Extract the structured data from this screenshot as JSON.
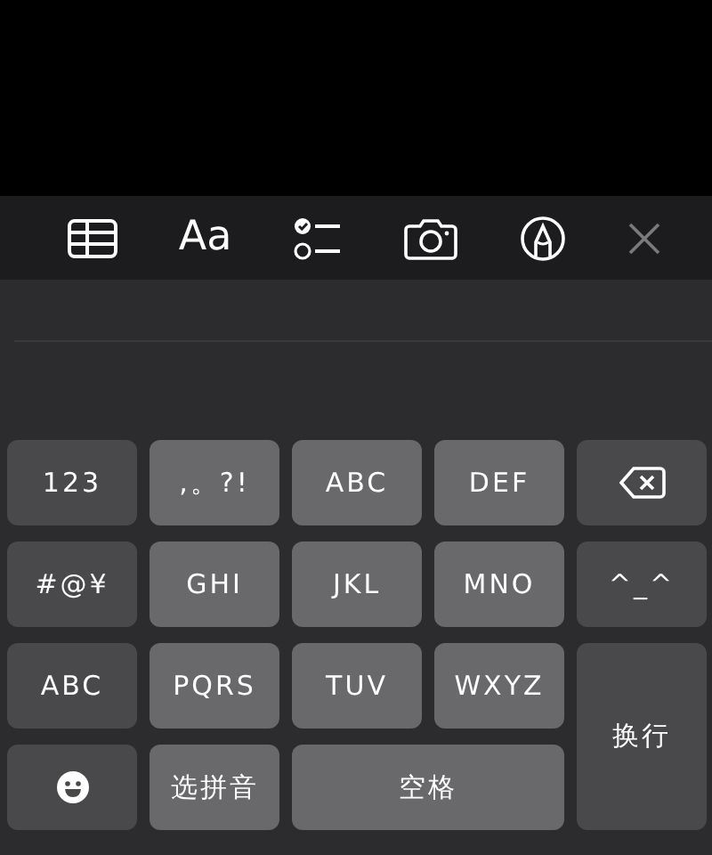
{
  "toolbar": [
    {
      "kind": "table"
    },
    {
      "kind": "format",
      "label": "Aa"
    },
    {
      "kind": "checklist"
    },
    {
      "kind": "camera"
    },
    {
      "kind": "markup"
    },
    {
      "kind": "close",
      "disabled": true
    }
  ],
  "keys": [
    {
      "kind": "function",
      "label": "123"
    },
    {
      "kind": "letter",
      "label": ",。?!"
    },
    {
      "kind": "letter",
      "label": "ABC"
    },
    {
      "kind": "letter",
      "label": "DEF"
    },
    {
      "kind": "delete"
    },
    {
      "kind": "function",
      "label": "#@¥"
    },
    {
      "kind": "letter",
      "label": "GHI"
    },
    {
      "kind": "letter",
      "label": "JKL"
    },
    {
      "kind": "letter",
      "label": "MNO"
    },
    {
      "kind": "function",
      "label": "^_^"
    },
    {
      "kind": "function",
      "label": "ABC"
    },
    {
      "kind": "letter",
      "label": "PQRS"
    },
    {
      "kind": "letter",
      "label": "TUV"
    },
    {
      "kind": "letter",
      "label": "WXYZ"
    },
    {
      "kind": "return",
      "label": "换行"
    },
    {
      "kind": "emoji"
    },
    {
      "kind": "letter",
      "label": "选拼音"
    },
    {
      "kind": "space",
      "label": "空格"
    }
  ]
}
